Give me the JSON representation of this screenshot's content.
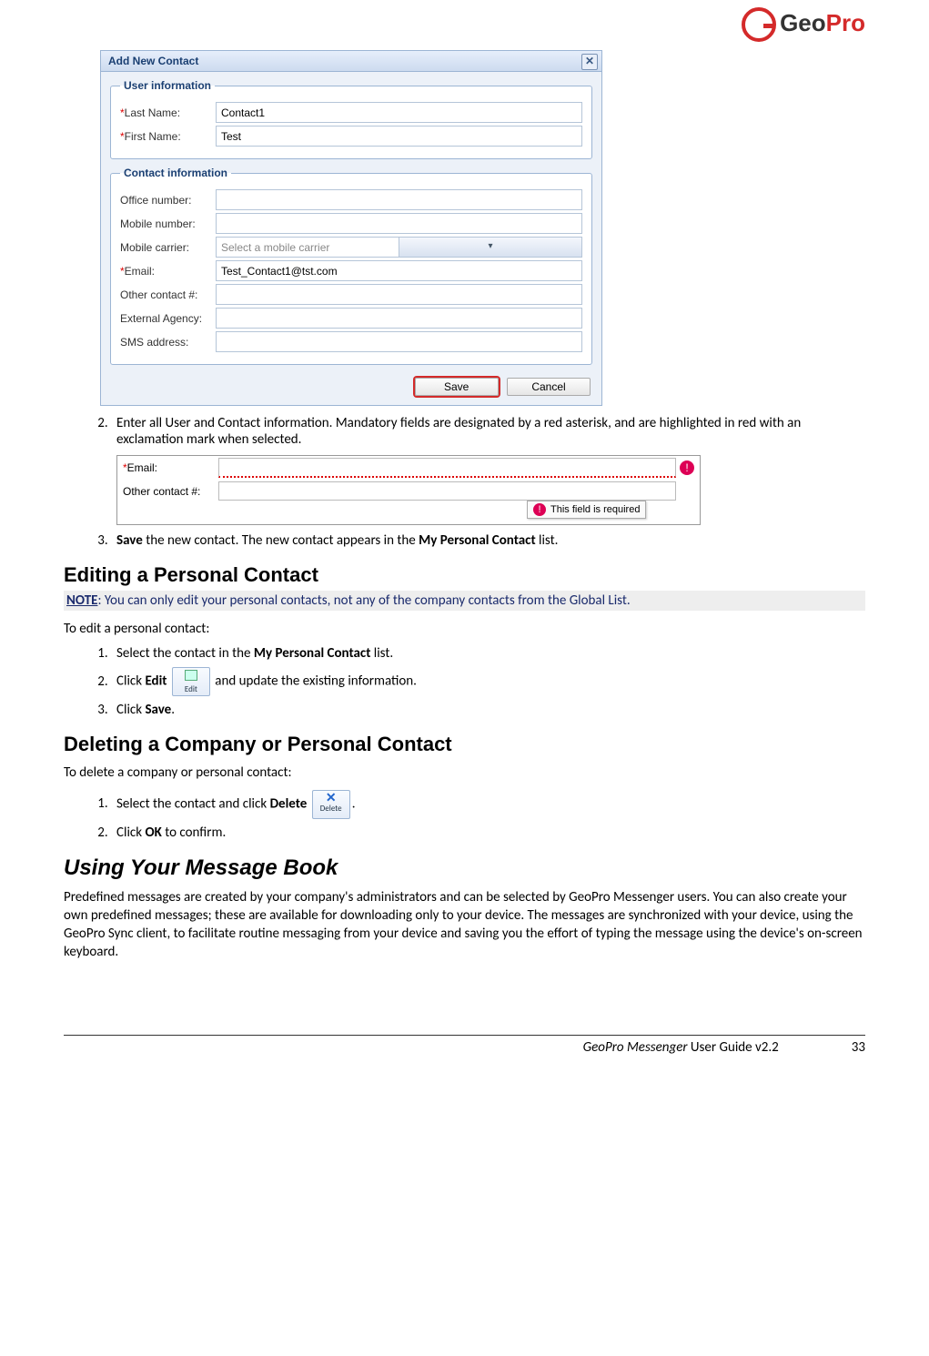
{
  "logo": {
    "geo": "Geo",
    "pro": "Pro"
  },
  "dialog": {
    "title": "Add New Contact",
    "close_glyph": "✕",
    "user_legend": "User information",
    "contact_legend": "Contact information",
    "last_name_label": "Last Name:",
    "last_name_value": "Contact1",
    "first_name_label": "First Name:",
    "first_name_value": "Test",
    "office_label": "Office number:",
    "mobile_label": "Mobile number:",
    "carrier_label": "Mobile carrier:",
    "carrier_placeholder": "Select a mobile carrier",
    "email_label": "Email:",
    "email_value": "Test_Contact1@tst.com",
    "other_label": "Other contact #:",
    "agency_label": "External Agency:",
    "sms_label": "SMS address:",
    "save_btn": "Save",
    "cancel_btn": "Cancel",
    "asterisk": "*"
  },
  "steps_a": {
    "s2": "Enter all User and Contact information. Mandatory fields are designated by a red asterisk, and are highlighted in red with an exclamation mark when selected.",
    "s3_a": "Save",
    "s3_b": " the new contact. The new contact appears in the ",
    "s3_c": "My Personal Contact",
    "s3_d": " list."
  },
  "err": {
    "email_label": "Email:",
    "other_label": "Other contact #:",
    "bang": "!",
    "tip": "This field is required",
    "asterisk": "*"
  },
  "edit": {
    "heading": "Editing a Personal Contact",
    "note_b": "NOTE",
    "note_rest": ": You can only edit your personal contacts, not any of the company contacts from the Global List.",
    "intro": "To edit a personal contact:",
    "s1_a": "Select the contact in the ",
    "s1_b": "My Personal Contact",
    "s1_c": " list.",
    "s2_a": "Click ",
    "s2_b": "Edit",
    "s2_c": " and update the existing information.",
    "edit_btn_label": "Edit",
    "s3_a": "Click ",
    "s3_b": "Save",
    "s3_c": "."
  },
  "del": {
    "heading": "Deleting a Company or Personal Contact",
    "intro": "To delete a company or personal contact:",
    "s1_a": "Select the contact and click ",
    "s1_b": "Delete",
    "s1_c": ".",
    "del_btn_label": "Delete",
    "del_x": "✕",
    "s2_a": "Click ",
    "s2_b": "OK",
    "s2_c": " to confirm."
  },
  "msgbook": {
    "heading": "Using Your Message Book",
    "para": "Predefined messages are created by your company's administrators and can be selected by GeoPro Messenger users. You can also create your own predefined messages; these are available for downloading only to your device. The messages are synchronized with your device, using the GeoPro Sync client, to facilitate routine messaging from your device and saving you the effort of typing the message using the device's on-screen keyboard."
  },
  "footer": {
    "title_a": "GeoPro Messenger",
    "title_b": " User Guide v2.2",
    "page": "33"
  }
}
